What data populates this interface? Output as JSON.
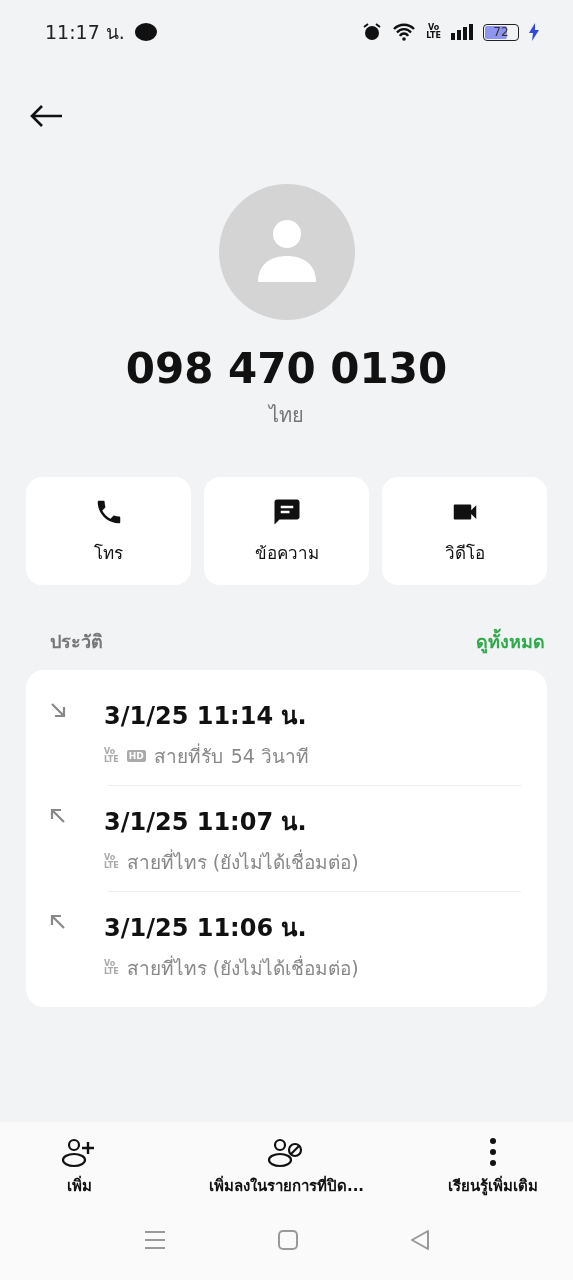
{
  "status_bar": {
    "time": "11:17 น.",
    "network_badge": [
      "Vo",
      "LTE"
    ],
    "battery": "72",
    "charging": true
  },
  "contact": {
    "number": "098 470 0130",
    "location": "ไทย"
  },
  "actions": [
    {
      "kind": "call",
      "label": "โทร"
    },
    {
      "kind": "message",
      "label": "ข้อความ"
    },
    {
      "kind": "video",
      "label": "วิดีโอ"
    }
  ],
  "history": {
    "title": "ประวัติ",
    "link": "ดูทั้งหมด",
    "calls": [
      {
        "kind": "incoming",
        "time": "3/1/25 11:14 น.",
        "badges": [
          [
            "Vo",
            "LTE"
          ],
          [
            "HD"
          ]
        ],
        "detail": "สายที่รับ",
        "duration": "54 วินาที"
      },
      {
        "kind": "outgoing",
        "time": "3/1/25 11:07 น.",
        "badges": [
          [
            "Vo",
            "LTE"
          ]
        ],
        "detail": "สายที่ไทร (ยังไม่ได้เชื่อมต่อ)"
      },
      {
        "kind": "outgoing",
        "time": "3/1/25 11:06 น.",
        "badges": [
          [
            "Vo",
            "LTE"
          ]
        ],
        "detail": "สายที่ไทร (ยังไม่ได้เชื่อมต่อ)"
      }
    ]
  },
  "bottom_actions": [
    {
      "kind": "add",
      "label": "เพิ่ม"
    },
    {
      "kind": "block",
      "label": "เพิ่มลงในรายการที่ปิด..."
    },
    {
      "kind": "more",
      "label": "เรียนรู้เพิ่มเติม"
    }
  ]
}
